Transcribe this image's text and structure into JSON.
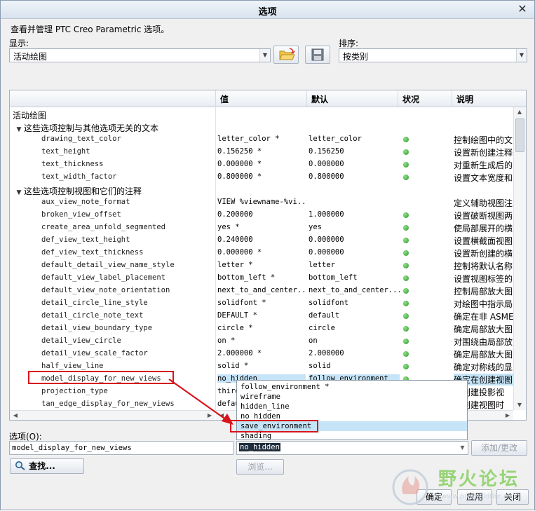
{
  "window": {
    "title": "选项"
  },
  "description": "查看并管理 PTC Creo Parametric 选项。",
  "show": {
    "label": "显示:",
    "value": "活动绘图"
  },
  "sort": {
    "label": "排序:",
    "value": "按类别"
  },
  "table": {
    "headers": {
      "value": "值",
      "default": "默认",
      "status": "状况",
      "description": "说明"
    },
    "root": "活动绘图",
    "groups": [
      {
        "label": "这些选项控制与其他选项无关的文本",
        "rows": [
          {
            "name": "drawing_text_color",
            "value": "letter_color *",
            "default": "letter_color",
            "desc": "控制绘图中的文"
          },
          {
            "name": "text_height",
            "value": "0.156250 *",
            "default": "0.156250",
            "desc": "设置新创建注释"
          },
          {
            "name": "text_thickness",
            "value": "0.000000 *",
            "default": "0.000000",
            "desc": "对重新生成后的"
          },
          {
            "name": "text_width_factor",
            "value": "0.800000 *",
            "default": "0.800000",
            "desc": "设置文本宽度和"
          }
        ]
      },
      {
        "label": "这些选项控制视图和它们的注释",
        "rows": [
          {
            "name": "aux_view_note_format",
            "value": "VIEW %viewname-%vi...",
            "default": "",
            "desc": "定义辅助视图注"
          },
          {
            "name": "broken_view_offset",
            "value": "0.200000",
            "default": "1.000000",
            "desc": "设置破断视图两"
          },
          {
            "name": "create_area_unfold_segmented",
            "value": "yes *",
            "default": "yes",
            "desc": "使局部展开的横"
          },
          {
            "name": "def_view_text_height",
            "value": "0.240000",
            "default": "0.000000",
            "desc": "设置横截面视图"
          },
          {
            "name": "def_view_text_thickness",
            "value": "0.000000 *",
            "default": "0.000000",
            "desc": "设置新创建的横"
          },
          {
            "name": "default_detail_view_name_style",
            "value": "letter *",
            "default": "letter",
            "desc": "控制将默认名称"
          },
          {
            "name": "default_view_label_placement",
            "value": "bottom_left *",
            "default": "bottom_left",
            "desc": "设置视图标签的"
          },
          {
            "name": "default_view_note_orientation",
            "value": "next_to_and_center...",
            "default": "next_to_and_center...",
            "desc": "控制局部放大图"
          },
          {
            "name": "detail_circle_line_style",
            "value": "solidfont *",
            "default": "solidfont",
            "desc": "对绘图中指示局"
          },
          {
            "name": "detail_circle_note_text",
            "value": "DEFAULT *",
            "default": "default",
            "desc": "确定在非 ASME-"
          },
          {
            "name": "detail_view_boundary_type",
            "value": "circle *",
            "default": "circle",
            "desc": "确定局部放大图"
          },
          {
            "name": "detail_view_circle",
            "value": "on *",
            "default": "on",
            "desc": "对围绕由局部放"
          },
          {
            "name": "detail_view_scale_factor",
            "value": "2.000000 *",
            "default": "2.000000",
            "desc": "确定局部放大图"
          },
          {
            "name": "half_view_line",
            "value": "solid *",
            "default": "solid",
            "desc": "确定对称线的显"
          },
          {
            "name": "model_display_for_new_views",
            "value": "no_hidden",
            "default": "follow_environment",
            "desc": "确定在创建视图"
          },
          {
            "name": "projection_type",
            "value": "third",
            "default": "",
            "desc": "在创建投影视"
          },
          {
            "name": "tan_edge_display_for_new_views",
            "value": "defau",
            "default": "",
            "desc": "在创建视图时"
          }
        ]
      }
    ]
  },
  "dropdown": {
    "options": [
      "follow_environment *",
      "wireframe",
      "hidden_line",
      "no_hidden",
      "save_environment",
      "shading"
    ],
    "selected_index": 4
  },
  "option": {
    "label": "选项(O):",
    "value": "model_display_for_new_views",
    "current_value": "no_hidden"
  },
  "buttons": {
    "add_change": "添加/更改",
    "find": "查找...",
    "browse": "浏览...",
    "ok": "确定",
    "apply": "应用",
    "close": "关闭"
  },
  "watermark": {
    "text": "野火论坛",
    "url": "www.proewildfire.cn"
  },
  "colors": {
    "highlight": "#c5e4f7",
    "annotation": "#d8141b",
    "status_ok": "#2f9a2c"
  }
}
